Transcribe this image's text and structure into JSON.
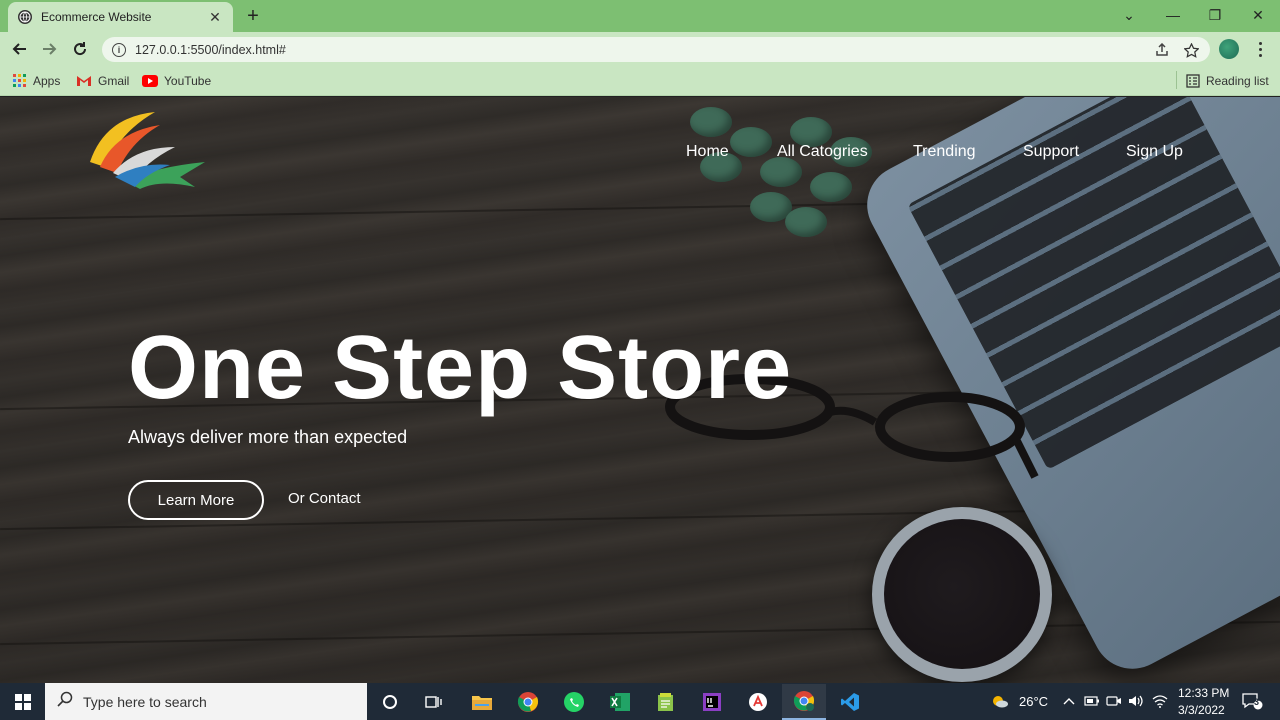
{
  "browser": {
    "tab_title": "Ecommerce Website",
    "tab_close": "✕",
    "new_tab": "+",
    "url": "127.0.0.1:5500/index.html#",
    "window_controls": {
      "minimize": "—",
      "restore": "❐",
      "close": "✕",
      "tab_search": "⌄"
    },
    "bookmarks": [
      {
        "label": "Apps",
        "icon": "apps-grid-icon"
      },
      {
        "label": "Gmail",
        "icon": "gmail-icon"
      },
      {
        "label": "YouTube",
        "icon": "youtube-icon"
      }
    ],
    "reading_list": "Reading list"
  },
  "site": {
    "nav": [
      "Home",
      "All Catogries",
      "Trending",
      "Support",
      "Sign Up"
    ],
    "hero_title": "One Step Store",
    "hero_subtitle": "Always deliver more than expected",
    "learn_more": "Learn More",
    "contact": "Or Contact"
  },
  "taskbar": {
    "search_placeholder": "Type here to search",
    "weather": "26°C",
    "time": "12:33 PM",
    "date": "3/3/2022",
    "notification_count": "3"
  },
  "colors": {
    "tabbar": "#7dbf72",
    "toolbar": "#c9e6c2",
    "taskbar": "#1f2a37",
    "hero_text": "#ffffff"
  }
}
